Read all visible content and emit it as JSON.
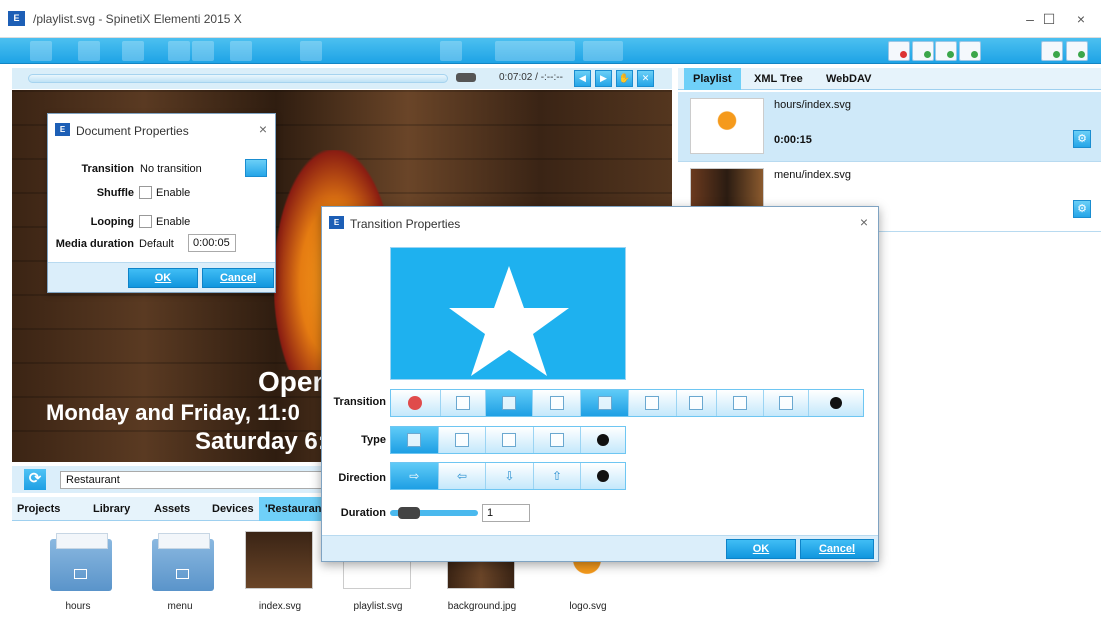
{
  "window": {
    "title": "/playlist.svg - SpinetiX Elementi 2015 X",
    "minimize": "–",
    "maximize": "☐",
    "close": "×"
  },
  "player": {
    "timecode": "0:07:02 / -:--:--"
  },
  "canvas_text": {
    "line1": "Open",
    "line2": "Monday and Friday, 11:0",
    "line3": "Saturday 6:"
  },
  "document_properties": {
    "title": "Document Properties",
    "transition_label": "Transition",
    "transition_value": "No transition",
    "shuffle_label": "Shuffle",
    "shuffle_value": "Enable",
    "looping_label": "Looping",
    "looping_value": "Enable",
    "media_duration_label": "Media duration",
    "media_duration_default": "Default",
    "media_duration_value": "0:00:05",
    "ok": "OK",
    "cancel": "Cancel",
    "close": "×"
  },
  "path": {
    "refresh_icon": "refresh-icon",
    "value": "Restaurant"
  },
  "library_tabs": [
    "Projects",
    "Library",
    "Assets",
    "Devices",
    "'Restaurant'"
  ],
  "files": [
    {
      "name": "hours",
      "kind": "folder"
    },
    {
      "name": "menu",
      "kind": "folder"
    },
    {
      "name": "index.svg",
      "kind": "thumb"
    },
    {
      "name": "playlist.svg",
      "kind": "thumb"
    },
    {
      "name": "background.jpg",
      "kind": "thumb"
    },
    {
      "name": "logo.svg",
      "kind": "thumb"
    }
  ],
  "right_panel": {
    "tabs": [
      "Playlist",
      "XML Tree",
      "WebDAV"
    ],
    "items": [
      {
        "name": "hours/index.svg",
        "duration": "0:00:15"
      },
      {
        "name": "menu/index.svg",
        "duration": ""
      }
    ]
  },
  "transition_properties": {
    "title": "Transition Properties",
    "transition_label": "Transition",
    "type_label": "Type",
    "direction_label": "Direction",
    "duration_label": "Duration",
    "duration_value": "1",
    "ok": "OK",
    "cancel": "Cancel",
    "close": "×"
  },
  "colors": {
    "accent": "#1ea3e6",
    "panel": "#dbeefa"
  }
}
